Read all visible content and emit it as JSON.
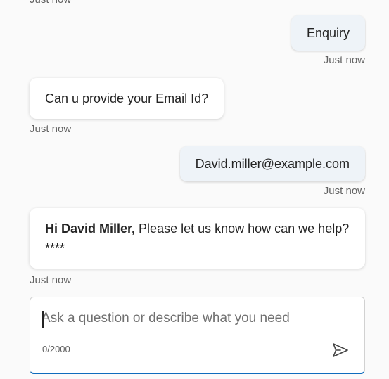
{
  "messages": {
    "top_timestamp": "Just now",
    "user_1": {
      "text": "Enquiry",
      "timestamp": "Just now"
    },
    "bot_1": {
      "text": "Can u provide your Email Id?",
      "timestamp": "Just now"
    },
    "user_2": {
      "text": "David.miller@example.com",
      "timestamp": "Just now"
    },
    "bot_2": {
      "bold_text": "Hi David Miller,",
      "text": " Please let us know how can we help?****",
      "timestamp": "Just now"
    }
  },
  "composer": {
    "placeholder": "Ask a question or describe what you need",
    "value": "",
    "counter": "0/2000",
    "send_icon": "send-icon"
  }
}
